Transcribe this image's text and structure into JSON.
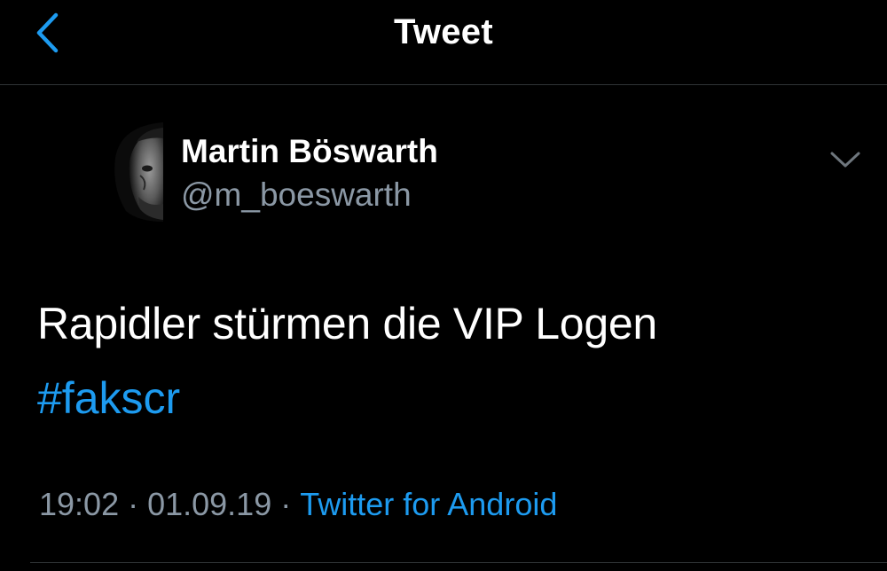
{
  "nav": {
    "title": "Tweet",
    "back_icon": "chevron-left-icon",
    "accent": "#1d9bf0"
  },
  "author": {
    "name": "Martin Böswarth",
    "handle": "@m_boeswarth",
    "avatar_icon": "avatar"
  },
  "tweet": {
    "text": "Rapidler stürmen die VIP Logen",
    "hashtag": "#fakscr",
    "time": "19:02",
    "date": "01.09.19",
    "source": "Twitter for Android",
    "separator": "·"
  },
  "colors": {
    "background": "#000000",
    "text": "#ffffff",
    "secondary": "#8b98a5",
    "link": "#1d9bf0"
  }
}
